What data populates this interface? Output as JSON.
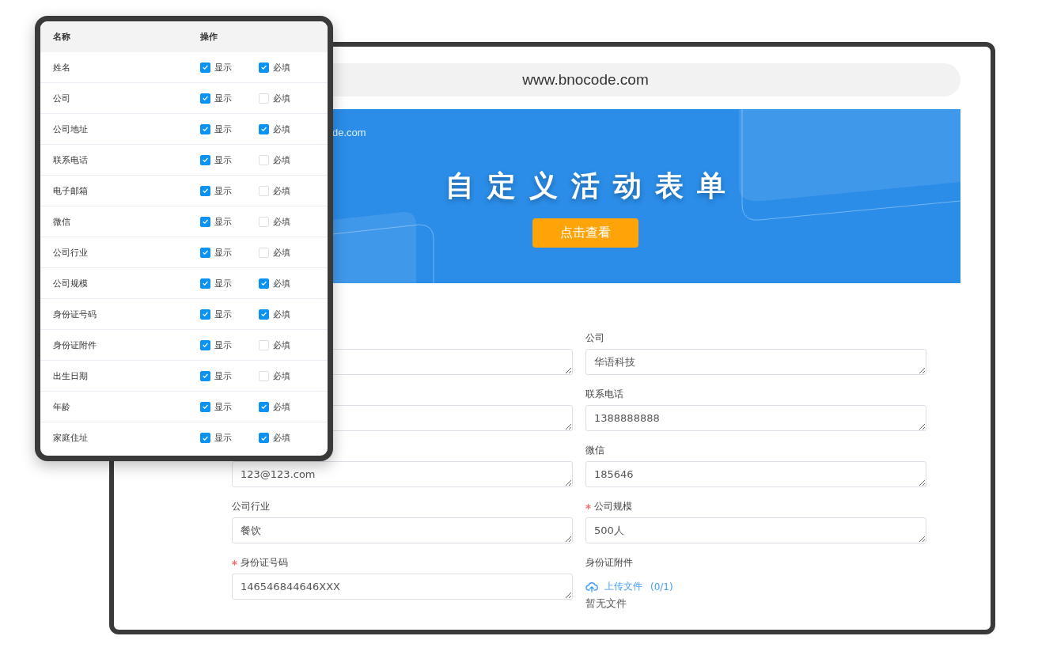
{
  "browser": {
    "address": "www.bnocode.com"
  },
  "banner": {
    "domain_fragment": "de.com",
    "title": "自定义活动表单",
    "button": "点击查看"
  },
  "form": {
    "left": [
      {
        "kind": "text",
        "required": false
      },
      {
        "kind": "text",
        "required": false
      },
      {
        "kind": "text",
        "required": false,
        "value": "123@123.com"
      },
      {
        "kind": "text",
        "required": false,
        "label": "公司行业",
        "value": "餐饮"
      },
      {
        "kind": "text",
        "required": true,
        "label": "身份证号码",
        "value": "146546844646XXX"
      }
    ],
    "right": [
      {
        "kind": "text",
        "required": false,
        "label": "公司",
        "value": "华语科技"
      },
      {
        "kind": "text",
        "required": false,
        "label": "联系电话",
        "value": "1388888888"
      },
      {
        "kind": "text",
        "required": false,
        "label": "微信",
        "value": "185646"
      },
      {
        "kind": "text",
        "required": true,
        "label": "公司规模",
        "value": "500人"
      },
      {
        "kind": "upload",
        "required": false,
        "label": "身份证附件",
        "upload_label": "上传文件",
        "count": "(0/1)",
        "empty_text": "暂无文件"
      }
    ]
  },
  "settings_panel": {
    "columns": [
      "名称",
      "操作"
    ],
    "rows": [
      {
        "name": "姓名",
        "options": [
          {
            "label": "显示",
            "checked": true
          },
          {
            "label": "必填",
            "checked": true
          }
        ]
      },
      {
        "name": "公司",
        "options": [
          {
            "label": "显示",
            "checked": true
          },
          {
            "label": "必填",
            "checked": false
          }
        ]
      },
      {
        "name": "公司地址",
        "options": [
          {
            "label": "显示",
            "checked": true
          },
          {
            "label": "必填",
            "checked": true
          }
        ]
      },
      {
        "name": "联系电话",
        "options": [
          {
            "label": "显示",
            "checked": true
          },
          {
            "label": "必填",
            "checked": false
          }
        ]
      },
      {
        "name": "电子邮箱",
        "options": [
          {
            "label": "显示",
            "checked": true
          },
          {
            "label": "必填",
            "checked": false
          }
        ]
      },
      {
        "name": "微信",
        "options": [
          {
            "label": "显示",
            "checked": true
          },
          {
            "label": "必填",
            "checked": false
          }
        ]
      },
      {
        "name": "公司行业",
        "options": [
          {
            "label": "显示",
            "checked": true
          },
          {
            "label": "必填",
            "checked": false
          }
        ]
      },
      {
        "name": "公司规模",
        "options": [
          {
            "label": "显示",
            "checked": true
          },
          {
            "label": "必填",
            "checked": true
          }
        ]
      },
      {
        "name": "身份证号码",
        "options": [
          {
            "label": "显示",
            "checked": true
          },
          {
            "label": "必填",
            "checked": true
          }
        ]
      },
      {
        "name": "身份证附件",
        "options": [
          {
            "label": "显示",
            "checked": true
          },
          {
            "label": "必填",
            "checked": false
          }
        ]
      },
      {
        "name": "出生日期",
        "options": [
          {
            "label": "显示",
            "checked": true
          },
          {
            "label": "必填",
            "checked": false
          }
        ]
      },
      {
        "name": "年龄",
        "options": [
          {
            "label": "显示",
            "checked": true
          },
          {
            "label": "必填",
            "checked": true
          }
        ]
      },
      {
        "name": "家庭住址",
        "options": [
          {
            "label": "显示",
            "checked": true
          },
          {
            "label": "必填",
            "checked": true
          }
        ]
      }
    ]
  }
}
